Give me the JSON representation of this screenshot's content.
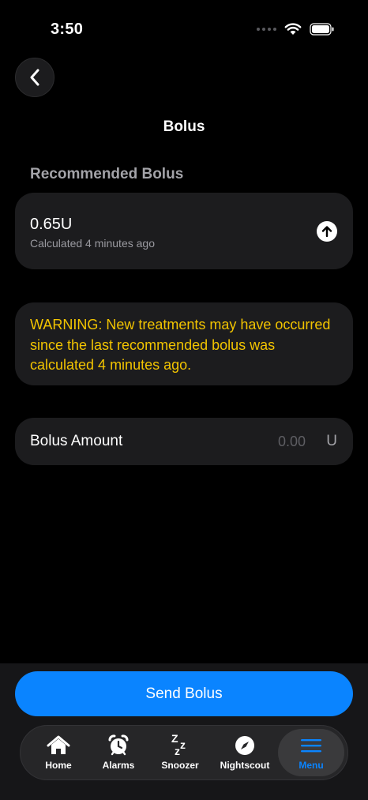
{
  "status": {
    "time": "3:50"
  },
  "nav": {
    "back_label": "Back",
    "title": "Bolus"
  },
  "recommended": {
    "header": "Recommended Bolus",
    "value": "0.65U",
    "subtitle": "Calculated 4 minutes ago",
    "apply_icon": "arrow-up-circle-icon"
  },
  "warning": {
    "text": "WARNING: New treatments may have occurred since the last recommended bolus was calculated 4 minutes ago.",
    "color": "#f2c400"
  },
  "amount": {
    "label": "Bolus Amount",
    "placeholder": "0.00",
    "unit": "U"
  },
  "send_button": {
    "label": "Send Bolus",
    "color": "#0a84ff"
  },
  "tabs": [
    {
      "label": "Home",
      "icon": "house-icon"
    },
    {
      "label": "Alarms",
      "icon": "alarm-clock-icon"
    },
    {
      "label": "Snoozer",
      "icon": "zzz-icon"
    },
    {
      "label": "Nightscout",
      "icon": "compass-icon"
    },
    {
      "label": "Menu",
      "icon": "menu-icon",
      "active": true
    }
  ]
}
